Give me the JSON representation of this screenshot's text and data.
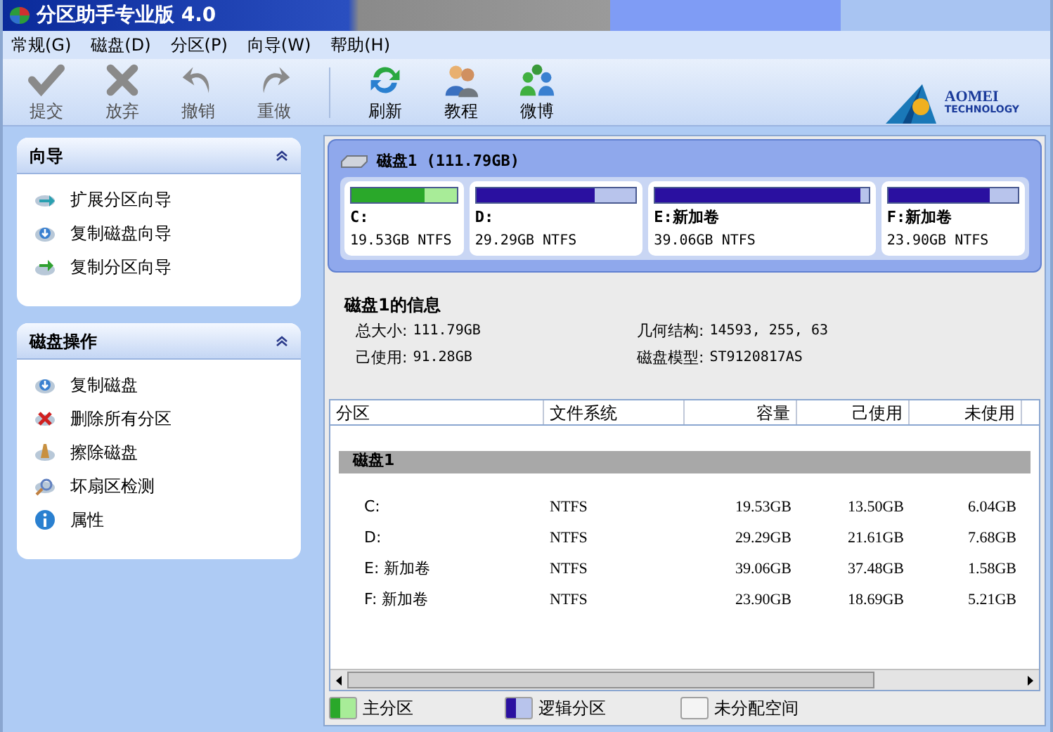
{
  "window": {
    "title": "分区助手专业版 4.0"
  },
  "menu": [
    "常规(G)",
    "磁盘(D)",
    "分区(P)",
    "向导(W)",
    "帮助(H)"
  ],
  "toolbar": [
    {
      "label": "提交",
      "kind": "check",
      "disabled": true
    },
    {
      "label": "放弃",
      "kind": "cross",
      "disabled": true
    },
    {
      "label": "撤销",
      "kind": "undo",
      "disabled": true
    },
    {
      "label": "重做",
      "kind": "redo",
      "disabled": true
    },
    {
      "label": "刷新",
      "kind": "refresh",
      "disabled": false
    },
    {
      "label": "教程",
      "kind": "people",
      "disabled": false
    },
    {
      "label": "微博",
      "kind": "group",
      "disabled": false
    }
  ],
  "logo": {
    "name": "AOMEI",
    "subtitle": "TECHNOLOGY"
  },
  "sidebar": [
    {
      "title": "向导",
      "expanded": true,
      "items": [
        {
          "label": "扩展分区向导",
          "kind": "extend"
        },
        {
          "label": "复制磁盘向导",
          "kind": "copy"
        },
        {
          "label": "复制分区向导",
          "kind": "copypart"
        }
      ]
    },
    {
      "title": "磁盘操作",
      "expanded": true,
      "items": [
        {
          "label": "复制磁盘",
          "kind": "copy"
        },
        {
          "label": "删除所有分区",
          "kind": "delete"
        },
        {
          "label": "擦除磁盘",
          "kind": "wipe"
        },
        {
          "label": "坏扇区检测",
          "kind": "scan"
        },
        {
          "label": "属性",
          "kind": "info"
        }
      ]
    }
  ],
  "disk": {
    "title": "磁盘1 (111.79GB)",
    "partitions": [
      {
        "name": "C:",
        "size": "19.53GB NTFS",
        "kind": "primary",
        "level": 0.69
      },
      {
        "name": "D:",
        "size": "29.29GB NTFS",
        "kind": "logical",
        "level": 0.74
      },
      {
        "name": "E:新加卷",
        "size": "39.06GB NTFS",
        "kind": "logical",
        "level": 0.96
      },
      {
        "name": "F:新加卷",
        "size": "23.90GB NTFS",
        "kind": "logical",
        "level": 0.78
      }
    ]
  },
  "info": {
    "title": "磁盘1的信息",
    "fields": [
      {
        "label": "总大小:",
        "value": "111.79GB"
      },
      {
        "label": "几何结构:",
        "value": "14593, 255, 63"
      },
      {
        "label": "己使用:",
        "value": "91.28GB"
      },
      {
        "label": "磁盘模型:",
        "value": "ST9120817AS"
      }
    ]
  },
  "table": {
    "columns": [
      "分区",
      "文件系统",
      "容量",
      "己使用",
      "未使用"
    ],
    "group": "磁盘1",
    "rows": [
      [
        "C:",
        "NTFS",
        "19.53GB",
        "13.50GB",
        "6.04GB"
      ],
      [
        "D:",
        "NTFS",
        "29.29GB",
        "21.61GB",
        "7.68GB"
      ],
      [
        "E: 新加卷",
        "NTFS",
        "39.06GB",
        "37.48GB",
        "1.58GB"
      ],
      [
        "F: 新加卷",
        "NTFS",
        "23.90GB",
        "18.69GB",
        "5.21GB"
      ]
    ]
  },
  "legend": [
    {
      "label": "主分区",
      "kind": "primary"
    },
    {
      "label": "逻辑分区",
      "kind": "logical"
    },
    {
      "label": "未分配空间",
      "kind": "unallocated"
    }
  ]
}
